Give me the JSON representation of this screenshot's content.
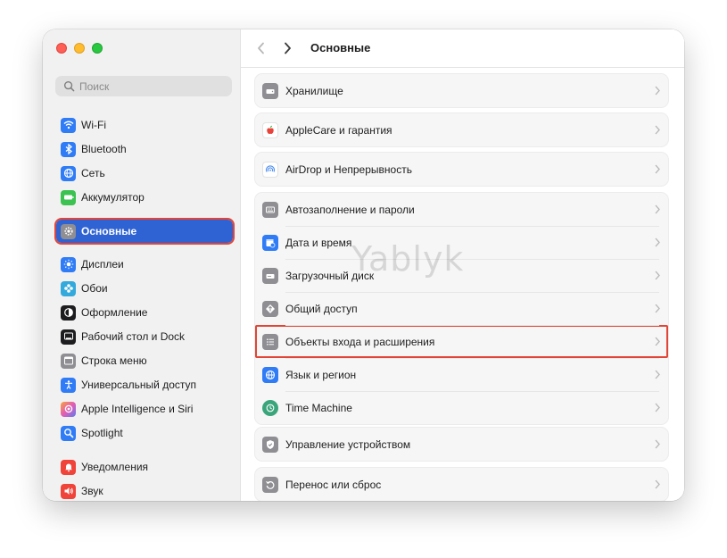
{
  "window": {
    "title": "Основные"
  },
  "toolbar": {
    "back_label": "‹",
    "forward_label": "›"
  },
  "search": {
    "placeholder": "Поиск",
    "value": ""
  },
  "sidebar": {
    "items": [
      {
        "label": "Wi-Fi",
        "icon": "wifi-icon",
        "color": "#2f7cf6"
      },
      {
        "label": "Bluetooth",
        "icon": "bluetooth-icon",
        "color": "#2f7cf6"
      },
      {
        "label": "Сеть",
        "icon": "globe-icon",
        "color": "#2f7cf6"
      },
      {
        "label": "Аккумулятор",
        "icon": "battery-icon",
        "color": "#3cc250"
      },
      {
        "label": "Основные",
        "icon": "gear-icon",
        "color": "#8e8e93",
        "selected": true
      },
      {
        "label": "Дисплеи",
        "icon": "sun-icon",
        "color": "#2f7cf6"
      },
      {
        "label": "Обои",
        "icon": "flower-icon",
        "color": "#34aadc"
      },
      {
        "label": "Оформление",
        "icon": "appearance-icon",
        "color": "#1d1d1f"
      },
      {
        "label": "Рабочий стол и Dock",
        "icon": "dock-icon",
        "color": "#1d1d1f"
      },
      {
        "label": "Строка меню",
        "icon": "menubar-icon",
        "color": "#8e8e93"
      },
      {
        "label": "Универсальный доступ",
        "icon": "accessibility-icon",
        "color": "#2f7cf6"
      },
      {
        "label": "Apple Intelligence и Siri",
        "icon": "siri-icon",
        "color": "#e45bb5"
      },
      {
        "label": "Spotlight",
        "icon": "search-icon",
        "color": "#2f7cf6"
      },
      {
        "label": "Уведомления",
        "icon": "bell-icon",
        "color": "#f0433a"
      },
      {
        "label": "Звук",
        "icon": "speaker-icon",
        "color": "#f0433a"
      }
    ]
  },
  "main": {
    "groups": [
      {
        "rows": [
          {
            "label": "Хранилище",
            "icon": "storage-icon",
            "color": "#8e8e93"
          }
        ]
      },
      {
        "rows": [
          {
            "label": "AppleCare и гарантия",
            "icon": "apple-icon",
            "color": "#ffffff"
          }
        ]
      },
      {
        "rows": [
          {
            "label": "AirDrop и Непрерывность",
            "icon": "airdrop-icon",
            "color": "#ffffff"
          }
        ]
      },
      {
        "rows": [
          {
            "label": "Автозаполнение и пароли",
            "icon": "keyboard-icon",
            "color": "#8e8e93"
          },
          {
            "label": "Дата и время",
            "icon": "calendar-clock-icon",
            "color": "#2f7cf6"
          },
          {
            "label": "Загрузочный диск",
            "icon": "disk-icon",
            "color": "#8e8e93"
          },
          {
            "label": "Общий доступ",
            "icon": "sharing-icon",
            "color": "#8e8e93"
          },
          {
            "label": "Объекты входа и расширения",
            "icon": "list-icon",
            "color": "#8e8e93",
            "highlight": true
          },
          {
            "label": "Язык и регион",
            "icon": "flag-icon",
            "color": "#2f7cf6"
          },
          {
            "label": "Time Machine",
            "icon": "time-machine-icon",
            "color": "#3aa57a"
          }
        ]
      },
      {
        "rows": [
          {
            "label": "Управление устройством",
            "icon": "checkmark-shield-icon",
            "color": "#8e8e93"
          }
        ]
      },
      {
        "rows": [
          {
            "label": "Перенос или сброс",
            "icon": "reset-icon",
            "color": "#8e8e93"
          }
        ]
      }
    ]
  },
  "watermark": {
    "text": "Yablyk"
  }
}
